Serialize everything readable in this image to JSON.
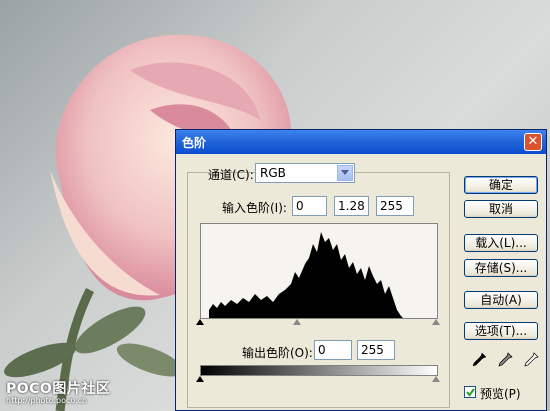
{
  "dialog": {
    "title": "色阶",
    "close_glyph": "✕",
    "channel_label": "通道(C):",
    "channel_value": "RGB",
    "input_levels_label": "输入色阶(I):",
    "input_levels": [
      "0",
      "1.28",
      "255"
    ],
    "output_levels_label": "输出色阶(O):",
    "output_levels": [
      "0",
      "255"
    ],
    "buttons": {
      "ok": "确定",
      "cancel": "取消",
      "load": "载入(L)...",
      "save": "存储(S)...",
      "auto": "自动(A)",
      "options": "选项(T)..."
    },
    "preview_label": "预览(P)",
    "preview_checked": true,
    "eyedroppers": [
      "black-eyedropper-icon",
      "gray-eyedropper-icon",
      "white-eyedropper-icon"
    ]
  },
  "watermark": {
    "brand": "POCO图片社区",
    "url": "http://photo.poco.cn"
  },
  "colors": {
    "titlebar": "#0b4ed0",
    "dialog_bg": "#ece9d8",
    "close": "#d9542f"
  }
}
